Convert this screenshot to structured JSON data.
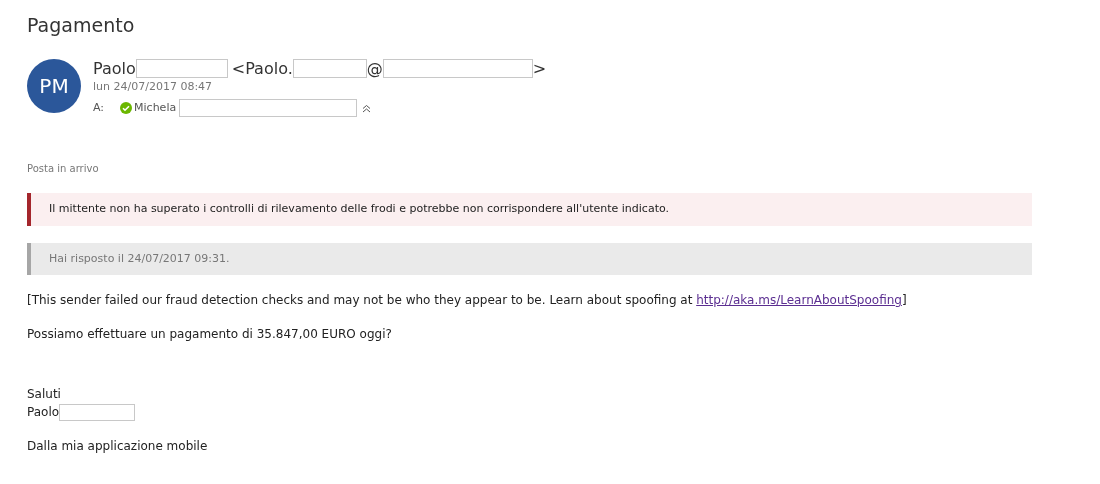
{
  "subject": "Pagamento",
  "sender": {
    "initials": "PM",
    "name": "Paolo",
    "address_open": "<Paolo.",
    "address_at": "@",
    "address_close": ">",
    "date": "lun 24/07/2017 08:47"
  },
  "recipients": {
    "label": "A:",
    "items": [
      {
        "name": "Michela",
        "verified": true
      }
    ]
  },
  "folder": "Posta in arrivo",
  "banners": [
    {
      "kind": "warning",
      "text": "Il mittente non ha superato i controlli di rilevamento delle frodi e potrebbe non corrispondere all'utente indicato."
    },
    {
      "kind": "info",
      "text": "Hai risposto il 24/07/2017 09:31."
    }
  ],
  "notice": {
    "text": "[This sender failed our fraud detection checks and may not be who they appear to be. Learn about spoofing at ",
    "link": "http://aka.ms/LearnAboutSpoofing",
    "after": "]"
  },
  "body": [
    "Possiamo effettuare un pagamento di 35.847,00 EURO oggi?"
  ],
  "signature": {
    "greeting": "Saluti",
    "name": "Paolo"
  },
  "footer": "Dalla mia applicazione mobile"
}
